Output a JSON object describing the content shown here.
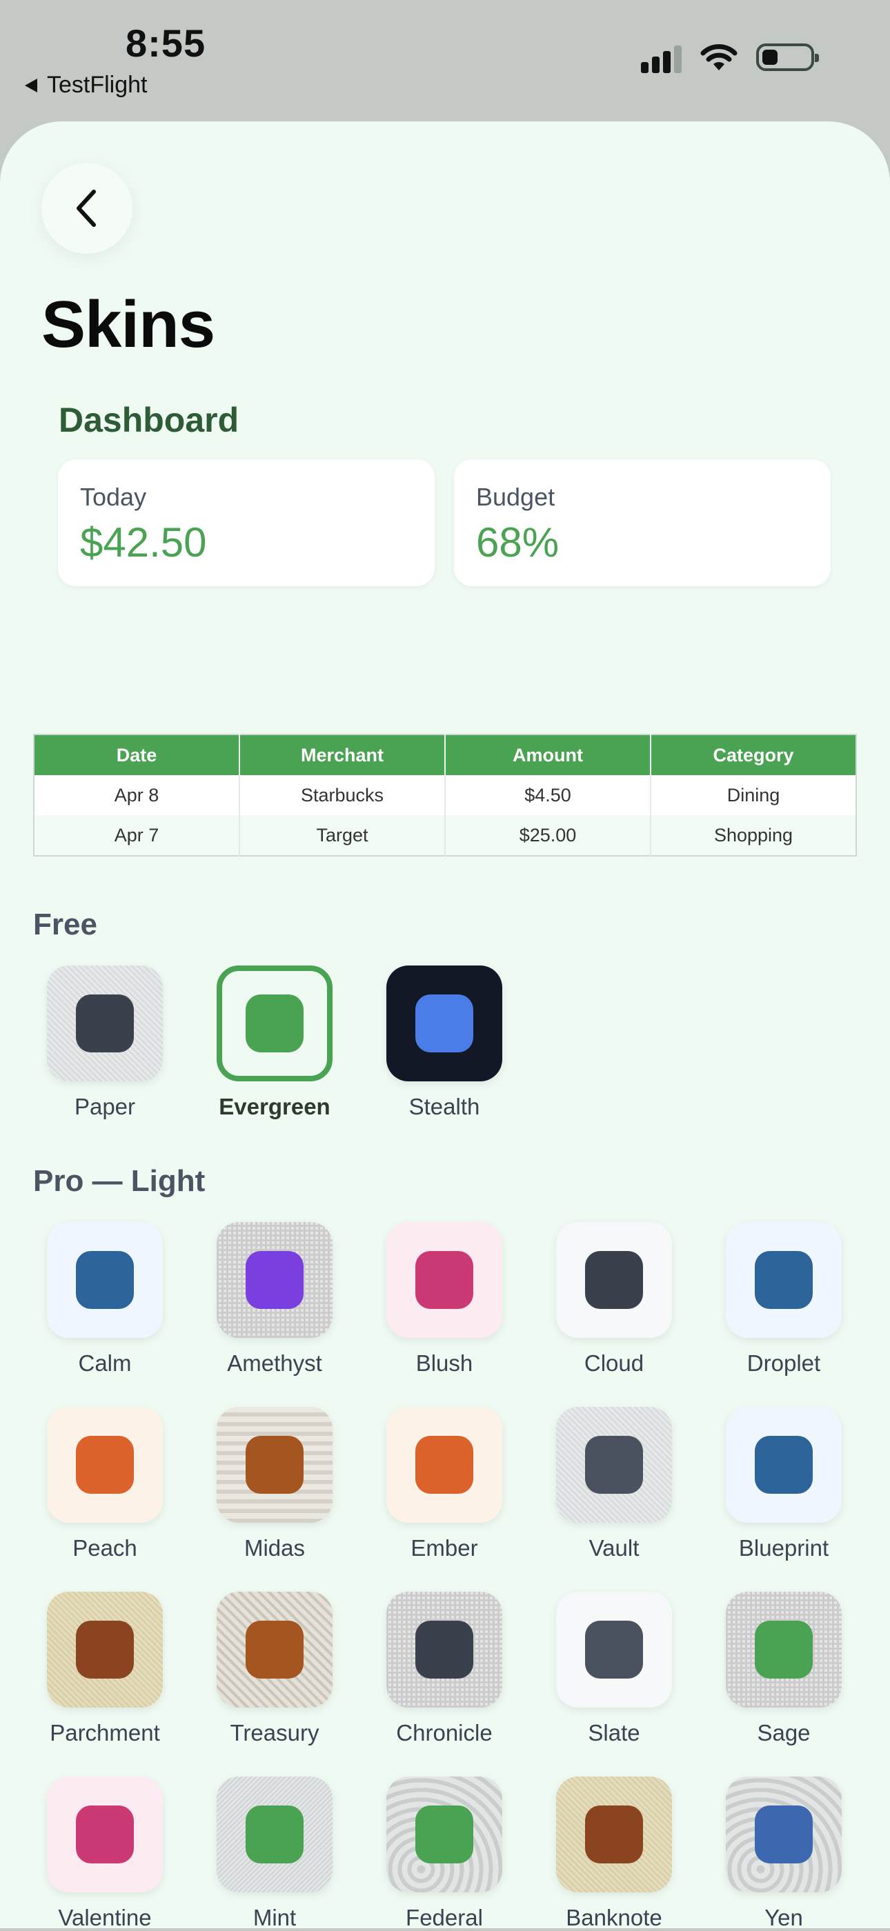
{
  "status": {
    "time": "8:55",
    "back_app": "TestFlight"
  },
  "page": {
    "title": "Skins"
  },
  "dashboard": {
    "title": "Dashboard",
    "cards": [
      {
        "label": "Today",
        "value": "$42.50"
      },
      {
        "label": "Budget",
        "value": "68%"
      }
    ]
  },
  "transactions": {
    "headers": [
      "Date",
      "Merchant",
      "Amount",
      "Category"
    ],
    "rows": [
      [
        "Apr 8",
        "Starbucks",
        "$4.50",
        "Dining"
      ],
      [
        "Apr 7",
        "Target",
        "$25.00",
        "Shopping"
      ]
    ]
  },
  "sections": [
    {
      "title": "Free",
      "skins": [
        {
          "name": "Paper",
          "bg": "paper",
          "swatch": "#3a404c"
        },
        {
          "name": "Evergreen",
          "bg": "selected",
          "swatch": "#4aa253",
          "selected": true
        },
        {
          "name": "Stealth",
          "bg": "#121826",
          "swatch": "#4b7de8"
        }
      ]
    },
    {
      "title": "Pro — Light",
      "skins": [
        {
          "name": "Calm",
          "bg": "#eff6fd",
          "swatch": "#2c6499"
        },
        {
          "name": "Amethyst",
          "bg": "check",
          "swatch": "#7a3fdf"
        },
        {
          "name": "Blush",
          "bg": "#fcecf1",
          "swatch": "#cc3a76"
        },
        {
          "name": "Cloud",
          "bg": "#f7f8f9",
          "swatch": "#3a404c"
        },
        {
          "name": "Droplet",
          "bg": "#eff6fd",
          "swatch": "#2c6499"
        },
        {
          "name": "Peach",
          "bg": "#fdf2e8",
          "swatch": "#dc622c"
        },
        {
          "name": "Midas",
          "bg": "lines",
          "swatch": "#a55520"
        },
        {
          "name": "Ember",
          "bg": "#fdf2e8",
          "swatch": "#dc622c"
        },
        {
          "name": "Vault",
          "bg": "paper",
          "swatch": "#4a5260"
        },
        {
          "name": "Blueprint",
          "bg": "#eff6fd",
          "swatch": "#2c6499"
        },
        {
          "name": "Parchment",
          "bg": "beige",
          "swatch": "#8b4420"
        },
        {
          "name": "Treasury",
          "bg": "diag",
          "swatch": "#a55520"
        },
        {
          "name": "Chronicle",
          "bg": "check",
          "swatch": "#3a404c"
        },
        {
          "name": "Slate",
          "bg": "#f7f8f9",
          "swatch": "#4a5260"
        },
        {
          "name": "Sage",
          "bg": "check",
          "swatch": "#4aa253"
        },
        {
          "name": "Valentine",
          "bg": "#fcecf1",
          "swatch": "#cc3a76"
        },
        {
          "name": "Mint",
          "bg": "fine",
          "swatch": "#4aa253"
        },
        {
          "name": "Federal",
          "bg": "swirl",
          "swatch": "#4aa253"
        },
        {
          "name": "Banknote",
          "bg": "beige",
          "swatch": "#8b4420"
        },
        {
          "name": "Yen",
          "bg": "swirl",
          "swatch": "#3c68b0"
        }
      ]
    }
  ]
}
